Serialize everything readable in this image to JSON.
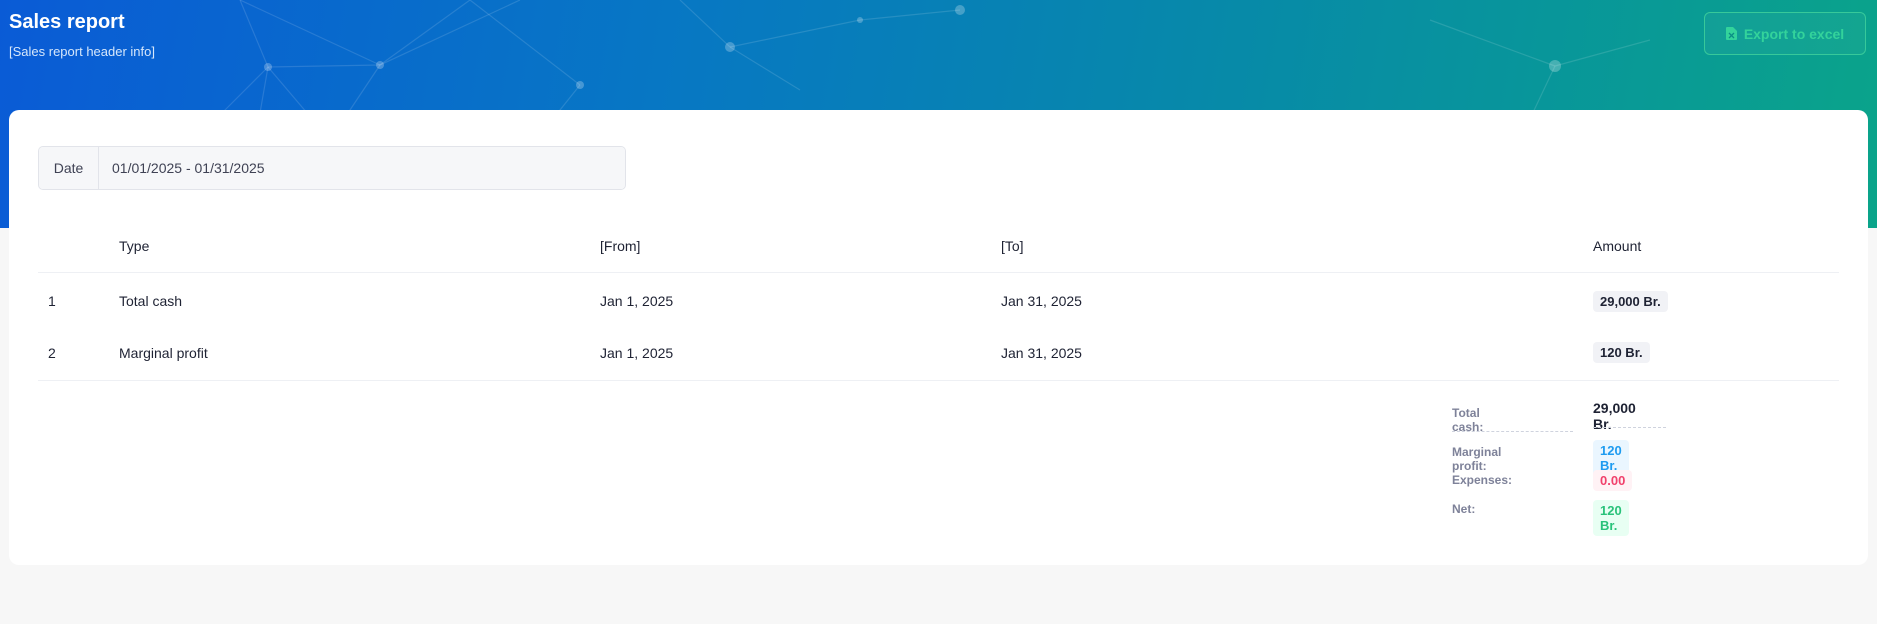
{
  "header": {
    "title": "Sales report",
    "subtitle": "[Sales report header info]",
    "export_label": "Export to excel"
  },
  "filters": {
    "date_label": "Date",
    "date_value": "01/01/2025 - 01/31/2025"
  },
  "table": {
    "columns": [
      "",
      "Type",
      "[From]",
      "[To]",
      "Amount"
    ],
    "rows": [
      {
        "num": "1",
        "type": "Total cash",
        "from": "Jan 1, 2025",
        "to": "Jan 31, 2025",
        "amount": "29,000 Br."
      },
      {
        "num": "2",
        "type": "Marginal profit",
        "from": "Jan 1, 2025",
        "to": "Jan 31, 2025",
        "amount": "120 Br."
      }
    ]
  },
  "summary": {
    "total_cash_label": "Total cash:",
    "total_cash_value": "29,000 Br.",
    "marginal_profit_label": "Marginal profit:",
    "marginal_profit_value": "120 Br.",
    "expenses_label": "Expenses:",
    "expenses_value": "0.00",
    "net_label": "Net:",
    "net_value": "120 Br."
  },
  "colors": {
    "accent_green": "#33d39b",
    "blue": "#1d9bf0",
    "red": "#f1416c",
    "green": "#29c27a"
  }
}
